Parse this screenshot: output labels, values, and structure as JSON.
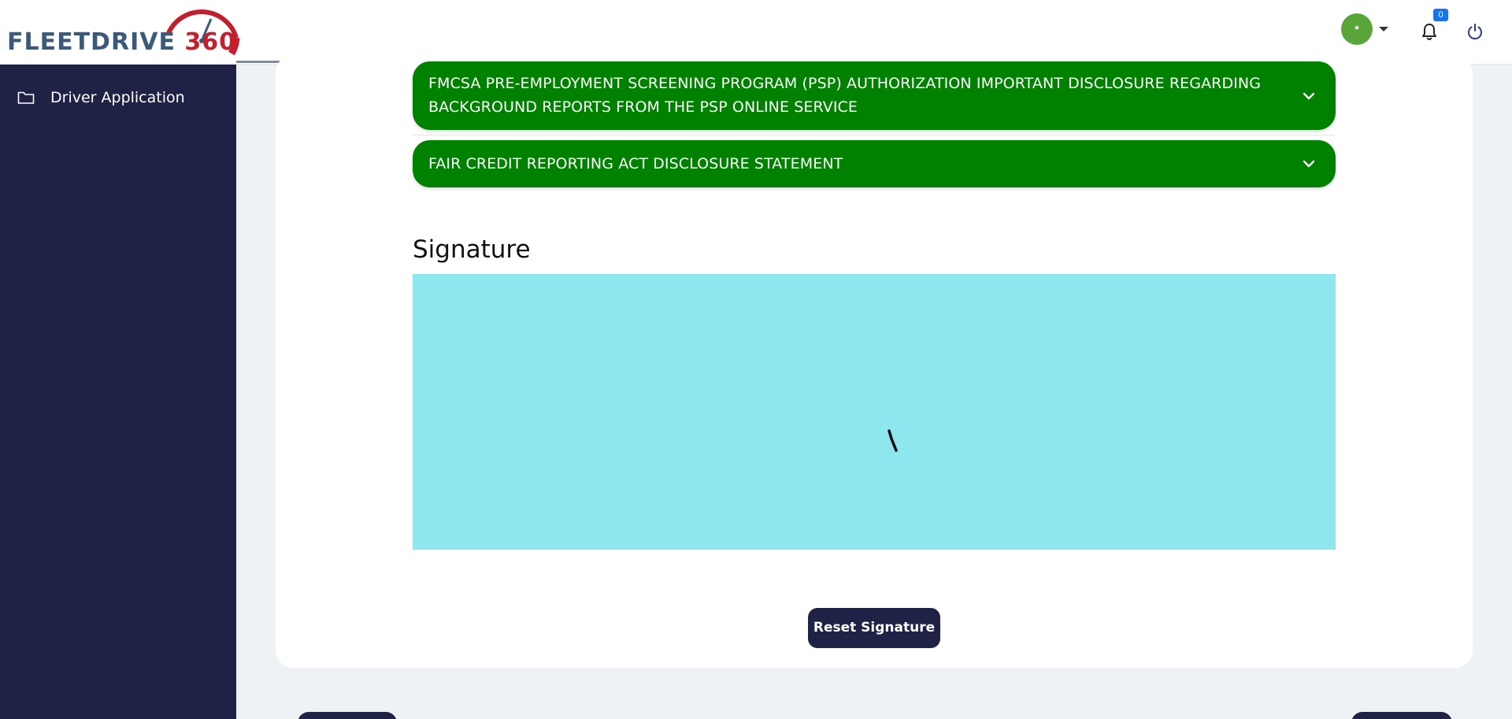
{
  "app": {
    "logo_text_main": "FLEETDRIVE ",
    "logo_text_num": "360",
    "brand_color": "#3b5a7a",
    "accent_red": "#c2202e"
  },
  "header": {
    "avatar_initial": "*",
    "avatar_color": "#5aa53a",
    "notification_count": "0",
    "icons": [
      "chevron-down-icon",
      "bell-icon",
      "power-icon"
    ]
  },
  "sidebar": {
    "background": "#1f2244",
    "items": [
      {
        "label": "Driver Application",
        "icon": "folder-icon"
      }
    ]
  },
  "main": {
    "accordions": [
      {
        "label": "FMCSA PRE-EMPLOYMENT SCREENING PROGRAM (PSP) AUTHORIZATION IMPORTANT DISCLOSURE REGARDING BACKGROUND REPORTS FROM THE PSP ONLINE SERVICE",
        "expanded": false,
        "color": "#008200"
      },
      {
        "label": "FAIR CREDIT REPORTING ACT DISCLOSURE STATEMENT",
        "expanded": false,
        "color": "#008200"
      }
    ],
    "signature": {
      "title": "Signature",
      "pad_color": "#8ee6ee",
      "reset_label": "Reset Signature"
    }
  }
}
